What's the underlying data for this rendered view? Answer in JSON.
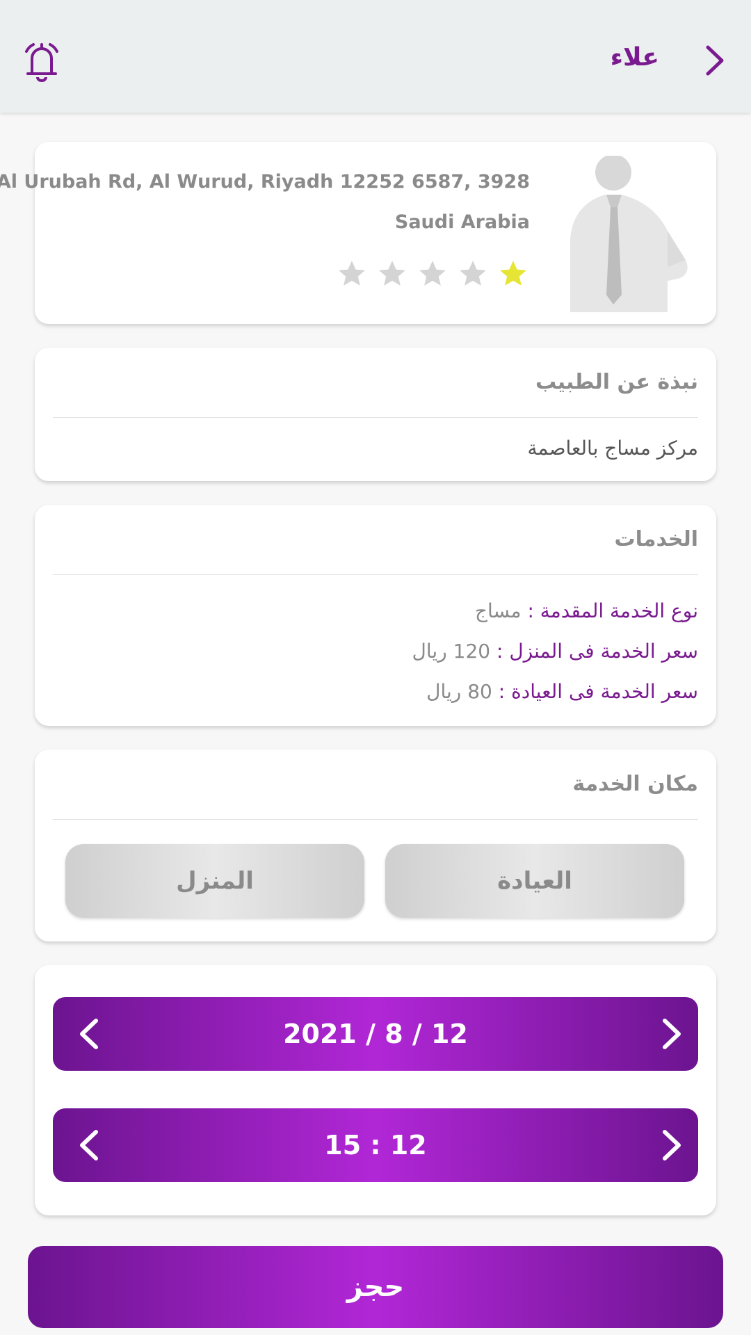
{
  "header": {
    "title": "علاء",
    "back_icon": "chevron-right-icon",
    "bell_icon": "bell-icon"
  },
  "profile": {
    "address_line1": "Al Urubah Rd, Al Wurud, Riyadh 12252 6587, 3928",
    "address_line2": "Saudi Arabia",
    "rating": 1,
    "rating_max": 5,
    "star_on_color": "#e6e535",
    "star_off_color": "#d4d4d4"
  },
  "about": {
    "title": "نبذة عن الطبيب",
    "text": "مركز مساج بالعاصمة"
  },
  "services": {
    "title": "الخدمات",
    "rows": [
      {
        "label": "نوع الخدمة المقدمة :",
        "value": "مساج"
      },
      {
        "label": "سعر الخدمة فى المنزل :",
        "value": "120 ريال"
      },
      {
        "label": "سعر الخدمة فى العيادة :",
        "value": "80 ريال"
      }
    ]
  },
  "place": {
    "title": "مكان الخدمة",
    "clinic_label": "العيادة",
    "home_label": "المنزل"
  },
  "schedule": {
    "date": "2021 / 8 / 12",
    "time": "15 : 12"
  },
  "book_label": "حجز",
  "colors": {
    "brand": "#7a1a8f",
    "brand_light": "#b127d6"
  }
}
